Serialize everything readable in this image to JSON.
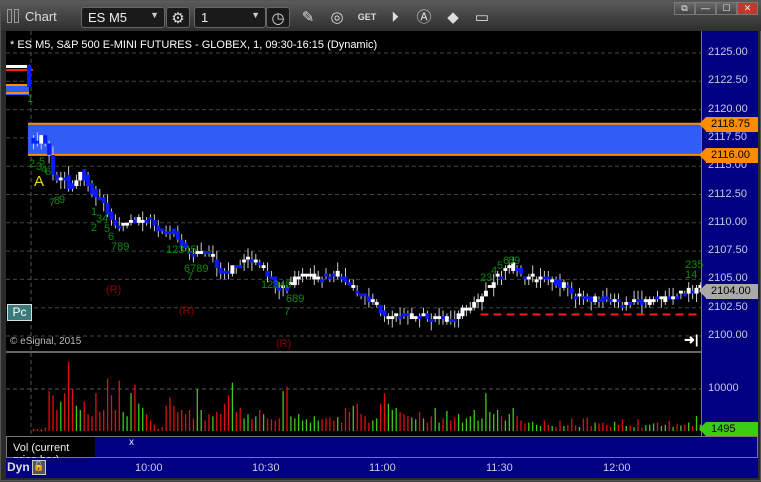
{
  "toolbar": {
    "title": "Chart",
    "symbol": "ES M5",
    "interval": "1",
    "icons": [
      "gear-icon",
      "clock-icon",
      "pencil-icon",
      "study-icon",
      "get-icon",
      "play-icon",
      "alert-icon",
      "tag-icon",
      "comment-icon"
    ]
  },
  "window_controls": {
    "link": "⧉",
    "minimize": "—",
    "maximize": "☐",
    "close": "✕"
  },
  "chart_header": "* ES M5, S&P 500 E-MINI FUTURES - GLOBEX, 1, 09:30-16:15 (Dynamic)",
  "copyright": "© eSignal, 2015",
  "pc_badge": "Pc",
  "colors": {
    "up": "#ffffff",
    "down": "#0a1aff",
    "zone": "#2f5df5",
    "zone_border": "#ff8c00",
    "vol_up": "#3ccc14",
    "vol_down": "#e01010",
    "axis_bg": "#000080"
  },
  "annotations": {
    "a_label": "A",
    "r_label": "(R)",
    "seq": [
      "1",
      "2",
      "3",
      "4",
      "6",
      "5",
      "7",
      "8",
      "9",
      "1",
      "34",
      "2",
      "5",
      "6",
      "789",
      "12345",
      "6789",
      "7",
      "12345",
      "689",
      "7",
      "23",
      "4",
      "5",
      "6",
      "89",
      "235",
      "14"
    ]
  },
  "chart_data": {
    "type": "candlestick",
    "price_axis": {
      "ticks": [
        "2125.00",
        "2122.50",
        "2120.00",
        "2117.50",
        "2115.00",
        "2112.50",
        "2110.00",
        "2107.50",
        "2105.00",
        "2102.50",
        "2100.00"
      ],
      "range": [
        2099.5,
        2126.5
      ]
    },
    "zone": {
      "upper": "2118.75",
      "lower": "2116.00"
    },
    "current_price": "2104.00",
    "support_line": 2101.9,
    "close_keypoints_minute_price": [
      [
        0,
        2117.7
      ],
      [
        1.3,
        2116.8
      ],
      [
        2.8,
        2117.7
      ],
      [
        4.1,
        2117.0
      ],
      [
        5.4,
        2115.5
      ],
      [
        6.2,
        2113.7
      ],
      [
        7.4,
        2113.9
      ],
      [
        8.7,
        2114.4
      ],
      [
        10.5,
        2112.8
      ],
      [
        12,
        2113.9
      ],
      [
        13.3,
        2114.6
      ],
      [
        14.6,
        2113.7
      ],
      [
        16.4,
        2112.4
      ],
      [
        19,
        2111.9
      ],
      [
        20.3,
        2110.6
      ],
      [
        22,
        2109.7
      ],
      [
        24,
        2110.0
      ],
      [
        28,
        2110.3
      ],
      [
        30.5,
        2110.2
      ],
      [
        33,
        2109.5
      ],
      [
        37,
        2109.1
      ],
      [
        39,
        2108.0
      ],
      [
        41,
        2107.1
      ],
      [
        43,
        2107.5
      ],
      [
        46,
        2107.1
      ],
      [
        48.5,
        2105.9
      ],
      [
        51,
        2105.7
      ],
      [
        53.6,
        2106.4
      ],
      [
        56,
        2106.8
      ],
      [
        58,
        2106.6
      ],
      [
        60,
        2105.9
      ],
      [
        63,
        2104.6
      ],
      [
        66,
        2104.4
      ],
      [
        69,
        2105.3
      ],
      [
        74,
        2105.3
      ],
      [
        79,
        2105.6
      ],
      [
        82,
        2104.4
      ],
      [
        84,
        2104.0
      ],
      [
        88,
        2102.8
      ],
      [
        92,
        2101.5
      ],
      [
        95,
        2101.8
      ],
      [
        100,
        2101.8
      ],
      [
        105,
        2101.5
      ],
      [
        109,
        2101.3
      ],
      [
        110,
        2102.0
      ],
      [
        112.5,
        2102.6
      ],
      [
        115,
        2103.1
      ],
      [
        118,
        2104.4
      ],
      [
        120,
        2105.3
      ],
      [
        124,
        2106.2
      ],
      [
        126,
        2105.3
      ],
      [
        129,
        2105.0
      ],
      [
        133,
        2105.0
      ],
      [
        137,
        2104.4
      ],
      [
        139.5,
        2103.5
      ],
      [
        143,
        2103.3
      ],
      [
        148.5,
        2103.1
      ],
      [
        153.5,
        2102.9
      ],
      [
        157.5,
        2102.9
      ],
      [
        161,
        2103.3
      ],
      [
        166,
        2103.5
      ],
      [
        169,
        2104.0
      ],
      [
        171,
        2104.2
      ]
    ],
    "time_axis": [
      "10:00",
      "10:30",
      "11:00",
      "11:30",
      "12:00"
    ],
    "volume": {
      "label": "Vol (current price bar)",
      "close_label": "x",
      "ticks": [
        "10000",
        "0"
      ],
      "current": "1495",
      "values": [
        500,
        400,
        300,
        800,
        9500,
        8500,
        5000,
        7000,
        9000,
        16500,
        10000,
        6000,
        5000,
        7000,
        4000,
        3500,
        9000,
        4500,
        5000,
        12500,
        8500,
        5000,
        12000,
        4500,
        3500,
        9000,
        11000,
        6500,
        5500,
        4000,
        2500,
        1500,
        500,
        1000,
        6000,
        8000,
        6000,
        4500,
        5000,
        4000,
        5000,
        3000,
        10000,
        5000,
        2500,
        4000,
        3500,
        4500,
        4000,
        6500,
        8500,
        11500,
        4500,
        5500,
        3000,
        4000,
        2800,
        3500,
        5000,
        4000,
        3000,
        2800,
        2500,
        3000,
        9500,
        10500,
        3500,
        3000,
        4000,
        2500,
        2800,
        2000,
        3500,
        2500,
        2800,
        3000,
        3200,
        2500,
        3300,
        2000,
        5500,
        4500,
        6000,
        6500,
        4000,
        3500,
        2000,
        2500,
        3000,
        6500,
        9000,
        6500,
        5000,
        5500,
        4500,
        4000,
        3500,
        3200,
        2800,
        4500,
        3000,
        2000,
        3500,
        5500,
        2000,
        3000,
        4800,
        2500,
        3200,
        4000,
        2000,
        3000,
        3500,
        5000,
        2500,
        3000,
        9000,
        4500,
        4000,
        5000,
        3500,
        2500,
        4000,
        5500,
        3500,
        2500,
        1800,
        2000,
        2200,
        1500,
        1200,
        2500,
        1500,
        1200,
        1000,
        2500,
        1200,
        1500,
        3000,
        1300,
        1000,
        3000,
        3200,
        1200,
        2000,
        1800,
        2000,
        1400,
        1000,
        2200,
        1500,
        2800,
        1200,
        1300,
        900,
        2800,
        800,
        1400,
        1500,
        1800,
        2000,
        1200,
        1500,
        2400,
        1000,
        1600,
        1300,
        1500,
        2000,
        1200,
        3600,
        1495
      ]
    }
  },
  "footer": {
    "mode": "Dyn"
  }
}
